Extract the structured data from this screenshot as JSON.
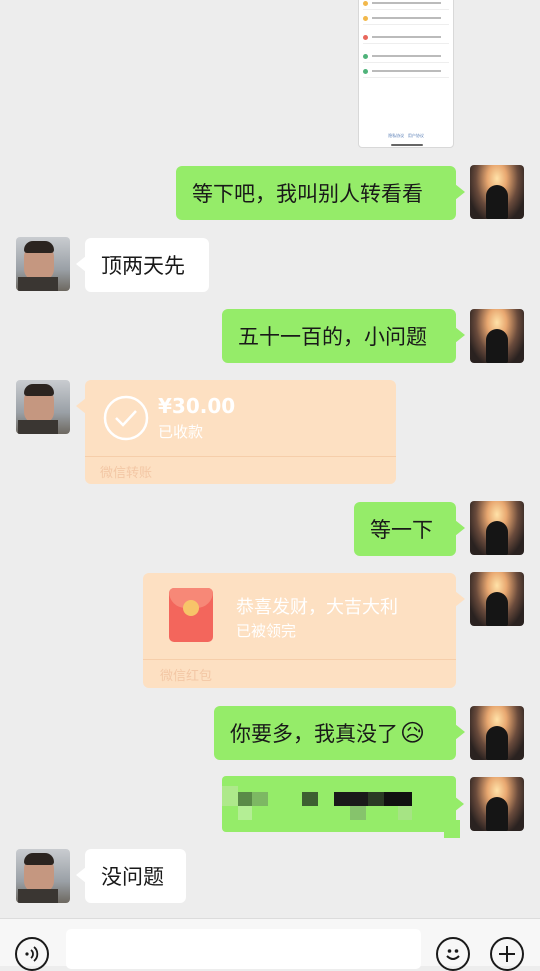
{
  "messages": {
    "m1_text": "等下吧，我叫别人转看看",
    "m2_text": "顶两天先",
    "m3_text": "五十一百的，小问题",
    "transfer": {
      "amount": "¥30.00",
      "status": "已收款",
      "footer": "微信转账"
    },
    "m5_text": "等一下",
    "red_packet": {
      "greeting": "恭喜发财，大吉大利",
      "status": "已被领完",
      "footer": "微信红包"
    },
    "m7_text": "你要多，我真没了",
    "m7_emoji": "😥",
    "m9_text": "没问题"
  },
  "shared_screenshot": {
    "footer_left": "隐私协议",
    "footer_right": "用户协议"
  },
  "colors": {
    "chat_bg": "#ededed",
    "self_bubble": "#95ec69",
    "other_bubble": "#ffffff",
    "transfer_card": "#fde0c2"
  },
  "icons": {
    "voice": "voice-icon",
    "emoji": "emoji-icon",
    "add": "plus-icon",
    "check": "check-circle-icon",
    "red_packet": "red-envelope-icon"
  }
}
